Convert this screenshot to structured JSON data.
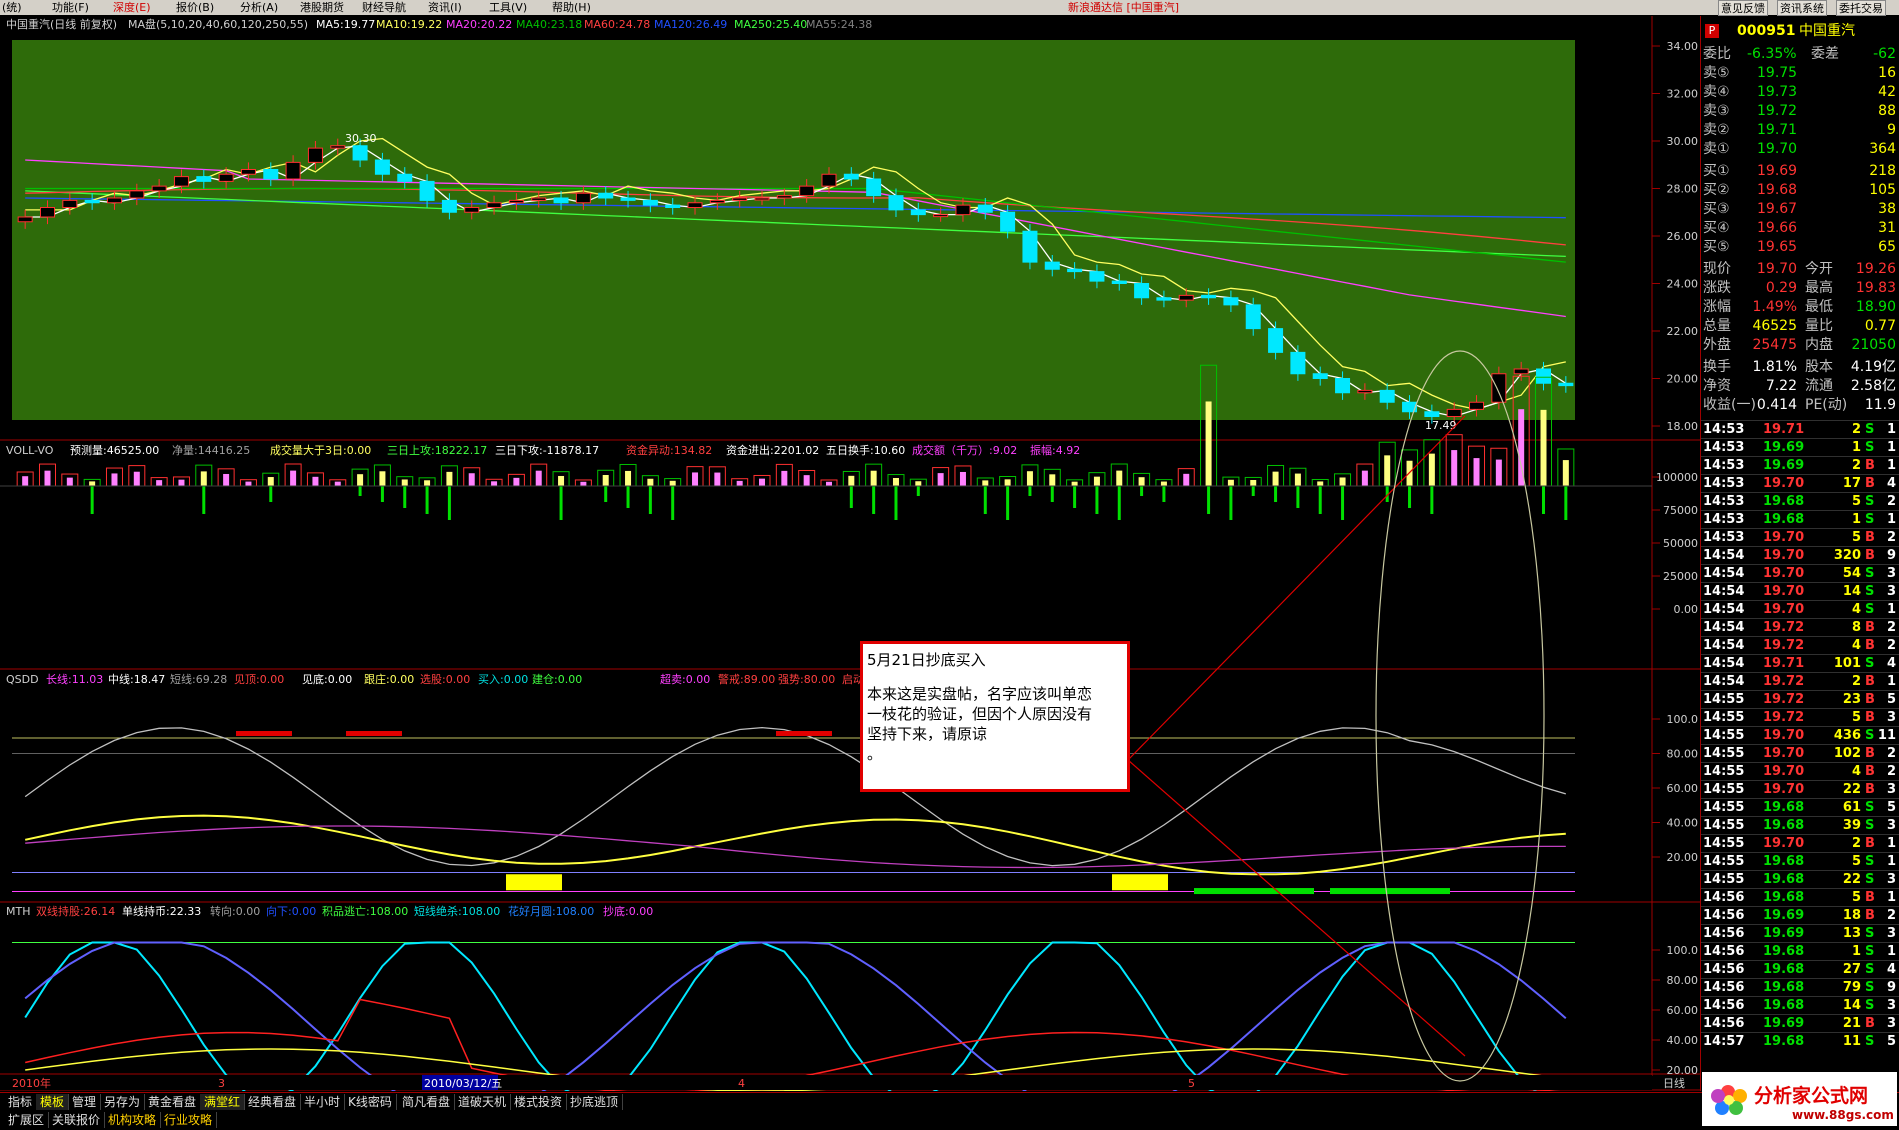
{
  "menu": {
    "items": [
      "(统)",
      "功能(F)",
      "深度(E)",
      "报价(B)",
      "分析(A)",
      "港股期货",
      "财经导航",
      "资讯(I)",
      "工具(V)",
      "帮助(H)"
    ],
    "active_index": 2,
    "app_title": "新浪通达信 [中国重汽]",
    "right_buttons": [
      "意见反馈",
      "资讯系统",
      "委托交易"
    ]
  },
  "main_chart": {
    "header": {
      "name": "中国重汽(日线 前复权)",
      "ma_label": "MA盘(5,10,20,40,60,120,250,55)",
      "ma5": "MA5:19.77",
      "ma10": "MA10:19.22",
      "ma20": "MA20:20.22",
      "ma40": "MA40:23.18",
      "ma60": "MA60:24.78",
      "ma120": "MA120:26.49",
      "ma250": "MA250:25.40",
      "ma55": "MA55:24.38"
    },
    "price_axis": [
      "34.00",
      "32.00",
      "30.00",
      "28.00",
      "26.00",
      "24.00",
      "22.00",
      "20.00",
      "18.00"
    ],
    "high_label": "30.30",
    "low_label": "17.49",
    "colors": {
      "background": "#2e6b0a",
      "up": "#ff3030",
      "down": "#00e8ff",
      "ma5": "#ffffff",
      "ma10": "#ffff60",
      "ma20": "#ff40ff",
      "ma40": "#00c000",
      "ma60": "#ff4040",
      "ma120": "#2050ff",
      "ma250": "#40ff40"
    }
  },
  "voll": {
    "name": "VOLL-VO",
    "predict": "预测量:46525.00",
    "net": "净量:14416.25",
    "vol3d": "成交量大于3日:0.00",
    "up3d": "三日上攻:18222.17",
    "down3d": "三日下攻:-11878.17",
    "fund_move": "资金异动:134.82",
    "fund_io": "资金进出:2201.02",
    "turnover5": "五日换手:10.60",
    "amount": "成交额（千万）:9.02",
    "amp": "振幅:4.92",
    "axis": [
      "100000",
      "75000",
      "50000",
      "25000",
      "0.00"
    ]
  },
  "qsdd": {
    "name": "QSDD",
    "long": "长线:11.03",
    "mid": "中线:18.47",
    "short": "短线:69.28",
    "top": "见顶:0.00",
    "bottom": "见底:0.00",
    "follow": "跟庄:0.00",
    "pick": "选股:0.00",
    "buy": "买入:0.00",
    "build": "建仓:0.00",
    "overbuy": "超卖:0.00",
    "alert": "警戒:89.00",
    "strong": "强势:80.00",
    "start": "启动",
    "axis": [
      "100.0",
      "80.00",
      "60.00",
      "40.00",
      "20.00"
    ]
  },
  "mth": {
    "name": "MTH",
    "dual": "双线持股:26.14",
    "single": "单线持币:22.33",
    "turn": "转向:0.00",
    "down": "向下:0.00",
    "escape": "积品逃亡:108.00",
    "short_kill": "短线绝杀:108.00",
    "flower": "花好月圆:108.00",
    "bottom": "抄底:0.00",
    "axis": [
      "100.0",
      "80.00",
      "60.00",
      "40.00",
      "20.00"
    ]
  },
  "time_axis": {
    "labels": [
      "2010年",
      "3",
      "2010/03/12/五",
      "4",
      "5"
    ],
    "period": "日线"
  },
  "annotation": {
    "title": "5月21日抄底买入",
    "body": [
      "本来这是实盘帖，名字应该叫单恋",
      "一枝花的验证，但因个人原因没有",
      "坚持下来，请原谅",
      "。"
    ]
  },
  "quote": {
    "code": "000951",
    "name": "中国重汽",
    "weibi_label": "委比",
    "weibi": "-6.35%",
    "weicha_label": "委差",
    "weicha": "-62",
    "asks": [
      {
        "label": "卖⑤",
        "price": "19.75",
        "vol": "16"
      },
      {
        "label": "卖④",
        "price": "19.73",
        "vol": "42"
      },
      {
        "label": "卖③",
        "price": "19.72",
        "vol": "88"
      },
      {
        "label": "卖②",
        "price": "19.71",
        "vol": "9"
      },
      {
        "label": "卖①",
        "price": "19.70",
        "vol": "364"
      }
    ],
    "bids": [
      {
        "label": "买①",
        "price": "19.69",
        "vol": "218"
      },
      {
        "label": "买②",
        "price": "19.68",
        "vol": "105"
      },
      {
        "label": "买③",
        "price": "19.67",
        "vol": "38"
      },
      {
        "label": "买④",
        "price": "19.66",
        "vol": "31"
      },
      {
        "label": "买⑤",
        "price": "19.65",
        "vol": "65"
      }
    ],
    "stats": [
      {
        "l1": "现价",
        "v1": "19.70",
        "l2": "今开",
        "v2": "19.26",
        "c1": "red",
        "c2": "red"
      },
      {
        "l1": "涨跌",
        "v1": "0.29",
        "l2": "最高",
        "v2": "19.83",
        "c1": "red",
        "c2": "red"
      },
      {
        "l1": "涨幅",
        "v1": "1.49%",
        "l2": "最低",
        "v2": "18.90",
        "c1": "red",
        "c2": "green"
      },
      {
        "l1": "总量",
        "v1": "46525",
        "l2": "量比",
        "v2": "0.77",
        "c1": "yellow",
        "c2": "yellow"
      },
      {
        "l1": "外盘",
        "v1": "25475",
        "l2": "内盘",
        "v2": "21050",
        "c1": "red",
        "c2": "green"
      }
    ],
    "stats2": [
      {
        "l1": "换手",
        "v1": "1.81%",
        "l2": "股本",
        "v2": "4.19亿"
      },
      {
        "l1": "净资",
        "v1": "7.22",
        "l2": "流通",
        "v2": "2.58亿"
      },
      {
        "l1": "收益(一)",
        "v1": "0.414",
        "l2": "PE(动)",
        "v2": "11.9"
      }
    ]
  },
  "ticks": [
    [
      "14:53",
      "19.71",
      "2",
      "S",
      "1"
    ],
    [
      "14:53",
      "19.69",
      "1",
      "S",
      "1"
    ],
    [
      "14:53",
      "19.69",
      "2",
      "B",
      "1"
    ],
    [
      "14:53",
      "19.70",
      "17",
      "B",
      "4"
    ],
    [
      "14:53",
      "19.68",
      "5",
      "S",
      "2"
    ],
    [
      "14:53",
      "19.68",
      "1",
      "S",
      "1"
    ],
    [
      "14:53",
      "19.70",
      "5",
      "B",
      "2"
    ],
    [
      "14:54",
      "19.70",
      "320",
      "B",
      "9"
    ],
    [
      "14:54",
      "19.70",
      "54",
      "S",
      "3"
    ],
    [
      "14:54",
      "19.70",
      "14",
      "S",
      "3"
    ],
    [
      "14:54",
      "19.70",
      "4",
      "S",
      "1"
    ],
    [
      "14:54",
      "19.72",
      "8",
      "B",
      "2"
    ],
    [
      "14:54",
      "19.72",
      "4",
      "B",
      "2"
    ],
    [
      "14:54",
      "19.71",
      "101",
      "S",
      "4"
    ],
    [
      "14:54",
      "19.72",
      "2",
      "B",
      "1"
    ],
    [
      "14:55",
      "19.72",
      "23",
      "B",
      "5"
    ],
    [
      "14:55",
      "19.72",
      "5",
      "B",
      "3"
    ],
    [
      "14:55",
      "19.70",
      "436",
      "S",
      "11"
    ],
    [
      "14:55",
      "19.70",
      "102",
      "B",
      "2"
    ],
    [
      "14:55",
      "19.70",
      "4",
      "B",
      "2"
    ],
    [
      "14:55",
      "19.70",
      "22",
      "B",
      "3"
    ],
    [
      "14:55",
      "19.68",
      "61",
      "S",
      "5"
    ],
    [
      "14:55",
      "19.68",
      "39",
      "S",
      "3"
    ],
    [
      "14:55",
      "19.70",
      "2",
      "B",
      "1"
    ],
    [
      "14:55",
      "19.68",
      "5",
      "S",
      "1"
    ],
    [
      "14:55",
      "19.68",
      "22",
      "S",
      "3"
    ],
    [
      "14:56",
      "19.68",
      "5",
      "B",
      "1"
    ],
    [
      "14:56",
      "19.69",
      "18",
      "B",
      "2"
    ],
    [
      "14:56",
      "19.69",
      "13",
      "S",
      "3"
    ],
    [
      "14:56",
      "19.68",
      "1",
      "S",
      "1"
    ],
    [
      "14:56",
      "19.68",
      "27",
      "S",
      "4"
    ],
    [
      "14:56",
      "19.68",
      "79",
      "S",
      "9"
    ],
    [
      "14:56",
      "19.68",
      "14",
      "S",
      "3"
    ],
    [
      "14:56",
      "19.69",
      "21",
      "B",
      "3"
    ],
    [
      "14:57",
      "19.68",
      "11",
      "S",
      "5"
    ]
  ],
  "bottom_tabs": [
    "指标",
    "模板",
    "管理",
    "另存为",
    "黄金看盘",
    "满堂红",
    "经典看盘",
    "半小时",
    "K线密码",
    "简凡看盘",
    "道破天机",
    "楼式投资",
    "抄底逃顶"
  ],
  "bottom_tabs2": [
    "扩展区",
    "关联报价",
    "机构攻略",
    "行业攻略"
  ],
  "logo": {
    "text": "分析家公式网",
    "url_text": "www.88gs.com"
  }
}
